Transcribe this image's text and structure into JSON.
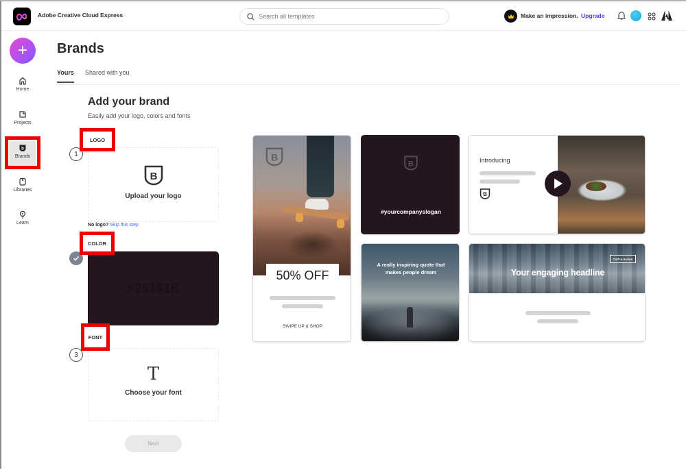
{
  "header": {
    "app_title": "Adobe Creative Cloud Express",
    "search_placeholder": "Search all templates",
    "promo_text": "Make an impression.",
    "upgrade_label": "Upgrade",
    "icons": [
      "creative-cloud-logo",
      "search-icon",
      "crown-icon",
      "bell-icon",
      "avatar",
      "apps-grid-icon",
      "adobe-logo"
    ]
  },
  "sidebar": {
    "create_label": "+",
    "items": [
      {
        "label": "Home",
        "icon": "home-icon"
      },
      {
        "label": "Projects",
        "icon": "projects-icon"
      },
      {
        "label": "Brands",
        "icon": "brands-icon",
        "active": true
      },
      {
        "label": "Libraries",
        "icon": "libraries-icon"
      },
      {
        "label": "Learn",
        "icon": "lightbulb-icon"
      }
    ]
  },
  "main": {
    "title": "Brands",
    "tabs": [
      {
        "label": "Yours",
        "active": true
      },
      {
        "label": "Shared with you",
        "active": false
      }
    ],
    "section_title": "Add your brand",
    "section_subtitle": "Easily add your logo, colors and fonts",
    "steps": {
      "logo": {
        "label": "LOGO",
        "number": "1",
        "card_text": "Upload your logo",
        "no_logo_text": "No logo?",
        "skip_link": "Skip this step"
      },
      "color": {
        "label": "COLOR",
        "completed": true,
        "swatch_hex": "#25151E",
        "swatch_color": "#25151e"
      },
      "font": {
        "label": "FONT",
        "number": "3",
        "glyph": "T",
        "card_text": "Choose your font"
      }
    },
    "next_label": "Next"
  },
  "templates": [
    {
      "type": "story",
      "offer": "50% OFF",
      "cta": "SWIPE UP & SHOP"
    },
    {
      "type": "square",
      "slogan": "#yourcompanyslogan"
    },
    {
      "type": "video",
      "intro": "Introducing"
    },
    {
      "type": "quote",
      "quote": "A really inspiring quote that makes people dream"
    },
    {
      "type": "banner",
      "headline": "Your engaging headline",
      "button": "Call to Action"
    }
  ],
  "colors": {
    "accent": "#4b3fd6",
    "highlight": "#ee0000",
    "brand_swatch": "#25151e",
    "link": "#3d6ae0"
  }
}
